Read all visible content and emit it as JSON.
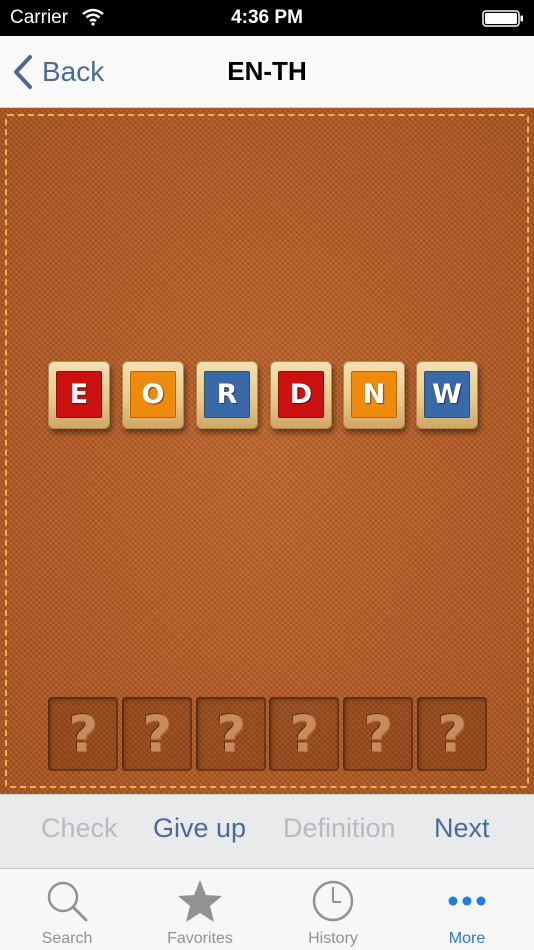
{
  "status_bar": {
    "carrier": "Carrier",
    "time": "4:36 PM"
  },
  "nav": {
    "back_label": "Back",
    "title": "EN-TH"
  },
  "tiles": [
    {
      "letter": "E",
      "color": "#cc1111"
    },
    {
      "letter": "O",
      "color": "#ee8a0c"
    },
    {
      "letter": "R",
      "color": "#3a69a8"
    },
    {
      "letter": "D",
      "color": "#cc1111"
    },
    {
      "letter": "N",
      "color": "#ee8a0c"
    },
    {
      "letter": "W",
      "color": "#3a69a8"
    }
  ],
  "slots": [
    "?",
    "?",
    "?",
    "?",
    "?",
    "?"
  ],
  "actions": {
    "check": "Check",
    "give_up": "Give up",
    "definition": "Definition",
    "next": "Next"
  },
  "tabs": [
    {
      "label": "Search",
      "icon": "search-icon"
    },
    {
      "label": "Favorites",
      "icon": "star-icon"
    },
    {
      "label": "History",
      "icon": "clock-icon"
    },
    {
      "label": "More",
      "icon": "more-icon",
      "active": true
    }
  ],
  "colors": {
    "accent": "#1e7ae6",
    "link": "#4a6b9a",
    "board": "#b45a20",
    "stitch": "#f0b050"
  }
}
